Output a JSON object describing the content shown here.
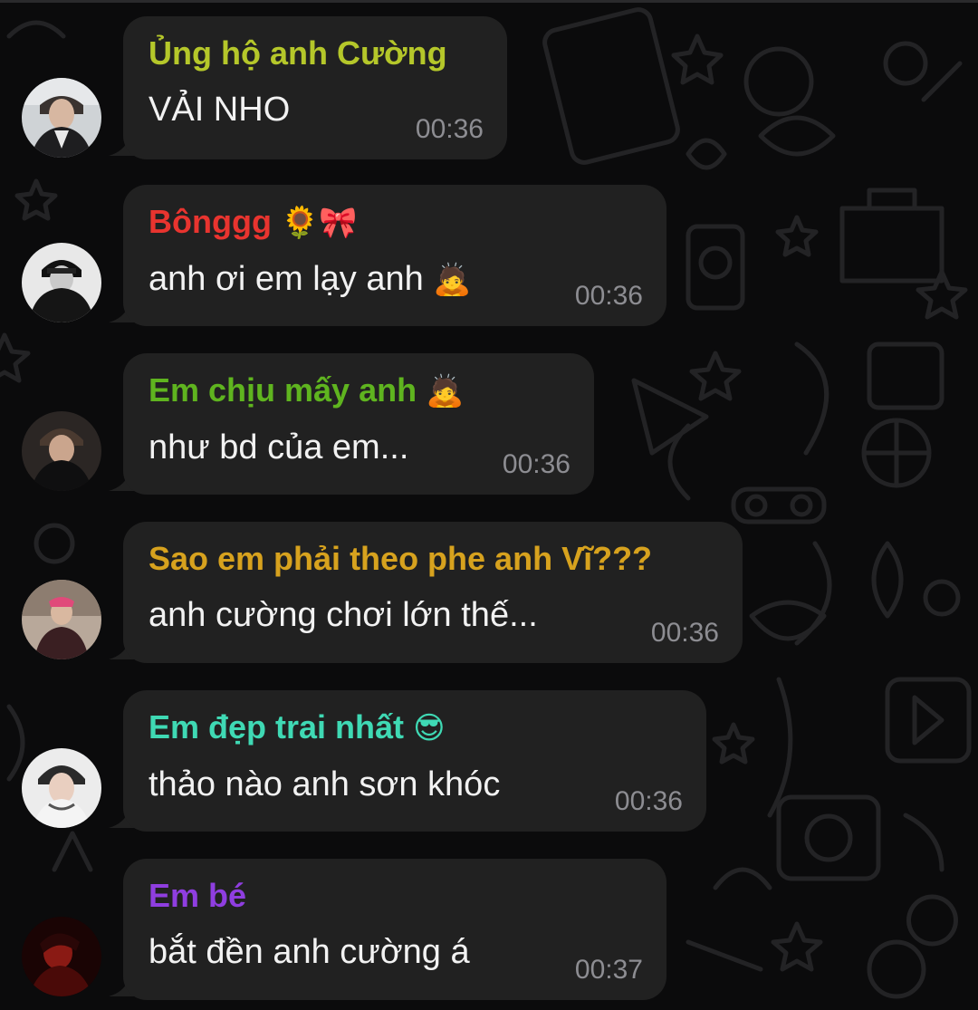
{
  "messages": [
    {
      "sender": "Ủng hộ anh Cường",
      "sender_emoji": "",
      "sender_color": "#b5c72a",
      "text": "VẢI NHO",
      "text_emoji": "",
      "time": "00:36"
    },
    {
      "sender": "Bônggg",
      "sender_emoji": "🌻🎀",
      "sender_color": "#e8342f",
      "text": "anh ơi em lạy anh",
      "text_emoji": "🙇",
      "time": "00:36"
    },
    {
      "sender": "Em chịu mấy anh",
      "sender_emoji": "🙇",
      "sender_color": "#5fb41f",
      "text": "như bd của em...",
      "text_emoji": "",
      "time": "00:36"
    },
    {
      "sender": "Sao em phải theo phe anh Vĩ???",
      "sender_emoji": "",
      "sender_color": "#d7a21e",
      "text": "anh cường chơi lớn thế...",
      "text_emoji": "",
      "time": "00:36"
    },
    {
      "sender": "Em đẹp trai nhất",
      "sender_emoji": "😎",
      "sender_color": "#3fd9b4",
      "text": "thảo nào anh sơn khóc",
      "text_emoji": "",
      "time": "00:36"
    },
    {
      "sender": "Em bé",
      "sender_emoji": "",
      "sender_color": "#8f3ee0",
      "text": "bắt đền anh cường á",
      "text_emoji": "",
      "time": "00:37"
    }
  ],
  "colors": {
    "background": "#0b0b0c",
    "bubble": "#212121",
    "message_text": "#f2f2f2",
    "timestamp": "#8d8d92"
  },
  "icons": {
    "avatar": "profile-photo",
    "background_pattern": "doodle-pattern"
  }
}
